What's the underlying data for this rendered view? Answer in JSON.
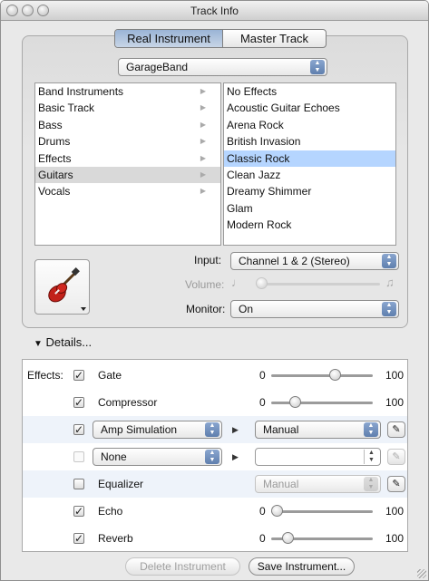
{
  "window": {
    "title": "Track Info"
  },
  "segments": {
    "real_instrument": "Real Instrument",
    "master_track": "Master Track"
  },
  "library_popup": {
    "value": "GarageBand"
  },
  "categories": [
    {
      "label": "Band Instruments"
    },
    {
      "label": "Basic Track"
    },
    {
      "label": "Bass"
    },
    {
      "label": "Drums"
    },
    {
      "label": "Effects"
    },
    {
      "label": "Guitars",
      "selected": true
    },
    {
      "label": "Vocals"
    }
  ],
  "presets": [
    {
      "label": "No Effects"
    },
    {
      "label": "Acoustic Guitar Echoes"
    },
    {
      "label": "Arena Rock"
    },
    {
      "label": "British Invasion"
    },
    {
      "label": "Classic Rock",
      "selected": true
    },
    {
      "label": "Clean Jazz"
    },
    {
      "label": "Dreamy Shimmer"
    },
    {
      "label": "Glam"
    },
    {
      "label": "Modern Rock"
    }
  ],
  "input": {
    "label": "Input:",
    "value": "Channel 1 & 2 (Stereo)"
  },
  "volume": {
    "label": "Volume:",
    "level": 0.0
  },
  "monitor": {
    "label": "Monitor:",
    "value": "On"
  },
  "details": {
    "label": "Details..."
  },
  "effects": {
    "label": "Effects:",
    "gate": {
      "name": "Gate",
      "checked": true,
      "min": "0",
      "max": "100",
      "level": 0.65
    },
    "compressor": {
      "name": "Compressor",
      "checked": true,
      "min": "0",
      "max": "100",
      "level": 0.2
    },
    "amp": {
      "value": "Amp Simulation",
      "checked": true,
      "preset": "Manual"
    },
    "slot4": {
      "value": "None",
      "checked": false,
      "preset": ""
    },
    "equalizer": {
      "name": "Equalizer",
      "checked": false,
      "preset": "Manual"
    },
    "echo": {
      "name": "Echo",
      "checked": true,
      "min": "0",
      "max": "100",
      "level": 0.0
    },
    "reverb": {
      "name": "Reverb",
      "checked": true,
      "min": "0",
      "max": "100",
      "level": 0.12
    }
  },
  "buttons": {
    "delete": "Delete Instrument",
    "save": "Save Instrument..."
  }
}
